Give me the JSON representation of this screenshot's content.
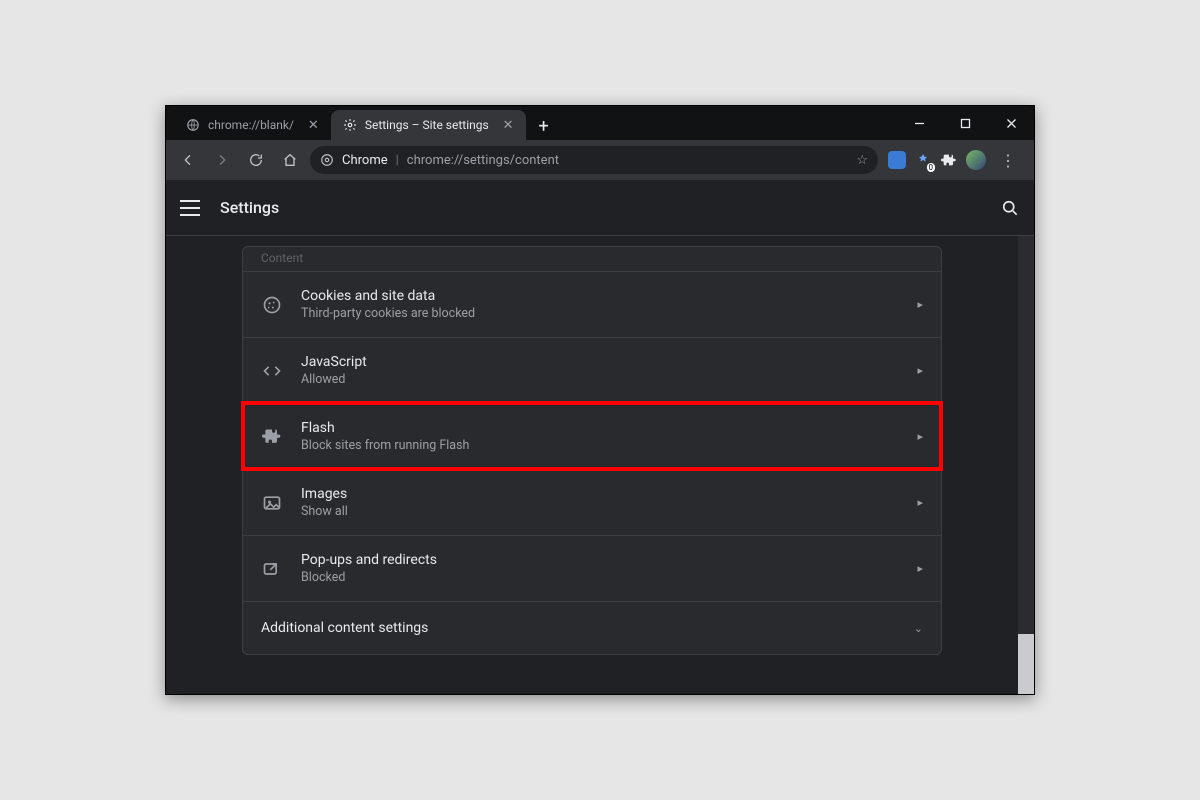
{
  "tabs": [
    {
      "label": "chrome://blank/",
      "active": false
    },
    {
      "label": "Settings – Site settings",
      "active": true
    }
  ],
  "omnibox": {
    "scheme_label": "Chrome",
    "url": "chrome://settings/content"
  },
  "appbar": {
    "title": "Settings"
  },
  "section_label": "Content",
  "rows": [
    {
      "id": "cookies",
      "title": "Cookies and site data",
      "sub": "Third-party cookies are blocked",
      "icon": "cookie",
      "highlight": false
    },
    {
      "id": "javascript",
      "title": "JavaScript",
      "sub": "Allowed",
      "icon": "code",
      "highlight": false
    },
    {
      "id": "flash",
      "title": "Flash",
      "sub": "Block sites from running Flash",
      "icon": "extension",
      "highlight": true
    },
    {
      "id": "images",
      "title": "Images",
      "sub": "Show all",
      "icon": "image",
      "highlight": false
    },
    {
      "id": "popups",
      "title": "Pop-ups and redirects",
      "sub": "Blocked",
      "icon": "popup",
      "highlight": false
    }
  ],
  "expander": {
    "title": "Additional content settings"
  },
  "highlight_color": "#ff0000"
}
